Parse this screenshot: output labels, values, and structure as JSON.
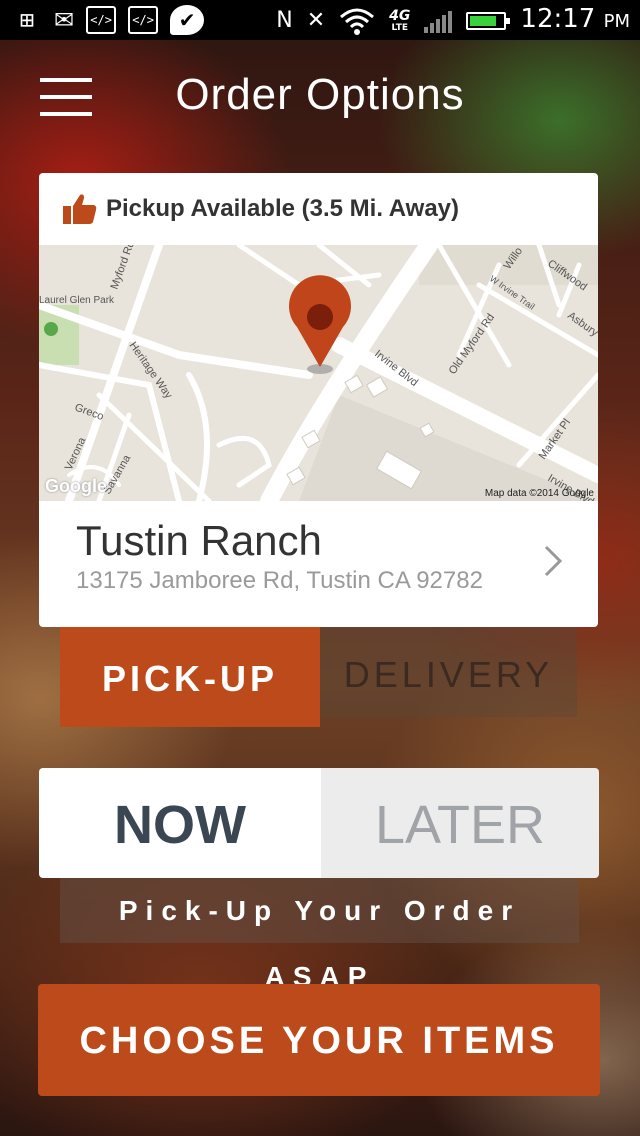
{
  "status_bar": {
    "network": "4G",
    "network_sub": "LTE",
    "time": "12:17",
    "ampm": "PM",
    "battery_percent": 80
  },
  "header": {
    "title": "Order Options"
  },
  "store_card": {
    "pickup_text": "Pickup Available (3.5 Mi. Away)",
    "map": {
      "credit": "Map data ©2014 Google",
      "google_logo": "Google",
      "labels": [
        "Myford Rd",
        "Laurel Glen Park",
        "Heritage Way",
        "Greco",
        "Verona",
        "Savanna",
        "Irvine Blvd",
        "Old Myford Rd",
        "W Irvine Trail",
        "Willo",
        "Cliffwood",
        "Asbury",
        "Market Pl",
        "Irvine Blvd"
      ]
    },
    "location_name": "Tustin Ranch",
    "address": "13175 Jamboree Rd, Tustin CA 92782"
  },
  "order_type": {
    "pickup_label": "PICK-UP",
    "delivery_label": "DELIVERY",
    "selected": "pickup"
  },
  "timing": {
    "now_label": "NOW",
    "later_label": "LATER",
    "selected": "now",
    "note": "Pick-Up Your Order ASAP"
  },
  "cta": {
    "label": "CHOOSE YOUR ITEMS"
  },
  "colors": {
    "accent": "#bd4a1a",
    "pin": "#c0451a"
  }
}
